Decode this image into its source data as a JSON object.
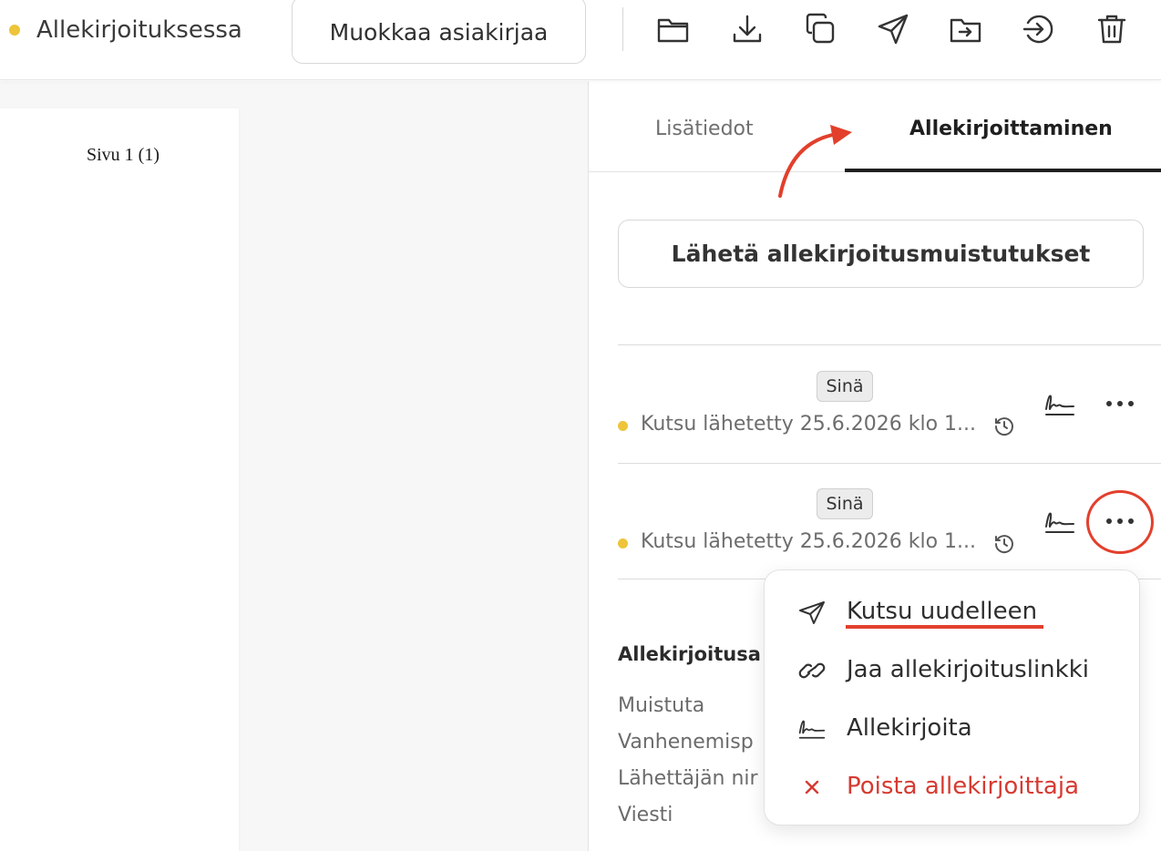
{
  "header": {
    "status_label": "Allekirjoituksessa",
    "edit_button_label": "Muokkaa asiakirjaa",
    "status_color": "#eec43a",
    "toolbar_icons": [
      "folder-icon",
      "download-icon",
      "copy-icon",
      "send-icon",
      "move-to-folder-icon",
      "export-icon",
      "trash-icon"
    ]
  },
  "document": {
    "page_number": "Sivu  1 (1)"
  },
  "panel": {
    "tabs": [
      {
        "label": "Lisätiedot",
        "active": false
      },
      {
        "label": "Allekirjoittaminen",
        "active": true
      }
    ],
    "reminder_button_label": "Lähetä allekirjoitusmuistutukset",
    "signers": [
      {
        "badge": "Sinä",
        "status": "Kutsu lähetetty 25.6.2026 klo 1..."
      },
      {
        "badge": "Sinä",
        "status": "Kutsu lähetetty 25.6.2026 klo 1..."
      }
    ],
    "settings_title": "Allekirjoitusa",
    "settings_fields": [
      "Muistuta",
      "Vanhenemisp",
      "Lähettäjän nir",
      "Viesti"
    ]
  },
  "menu": {
    "items": [
      {
        "label": "Kutsu uudelleen",
        "icon": "send-icon",
        "danger": false
      },
      {
        "label": "Jaa allekirjoituslinkki",
        "icon": "link-icon",
        "danger": false
      },
      {
        "label": "Allekirjoita",
        "icon": "signature-icon",
        "danger": false
      },
      {
        "label": "Poista allekirjoittaja",
        "icon": "close-icon",
        "danger": true
      }
    ]
  },
  "colors": {
    "accent_red": "#e2402c",
    "danger": "#d63a31",
    "pending_dot": "#eec43a"
  }
}
